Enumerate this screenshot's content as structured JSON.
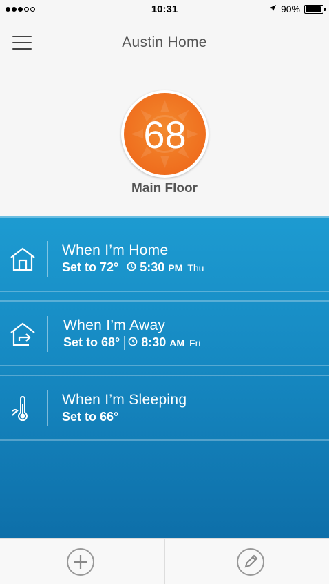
{
  "status_bar": {
    "time": "10:31",
    "battery": "90%",
    "battery_level": 0.9,
    "signal_icon": "signal-dots-icon",
    "location_icon": "location-arrow-icon"
  },
  "header": {
    "title": "Austin Home",
    "menu_icon": "hamburger-menu-icon"
  },
  "thermostat": {
    "temperature": "68",
    "zone": "Main Floor",
    "accent_color": "#ef6e1e",
    "icon": "sun-icon"
  },
  "schedule": {
    "color": "#1689c2",
    "items": [
      {
        "title": "When I’m Home",
        "set_to": "Set to 72°",
        "time": "5:30",
        "ampm": "PM",
        "day": "Thu",
        "icon": "house-icon"
      },
      {
        "title": "When I’m Away",
        "set_to": "Set to 68°",
        "time": "8:30",
        "ampm": "AM",
        "day": "Fri",
        "icon": "house-leave-icon"
      },
      {
        "title": "When I’m Sleeping",
        "set_to": "Set to 66°",
        "icon": "thermometer-moon-icon"
      }
    ]
  },
  "toolbar": {
    "add_icon": "plus-icon",
    "edit_icon": "pencil-icon"
  }
}
